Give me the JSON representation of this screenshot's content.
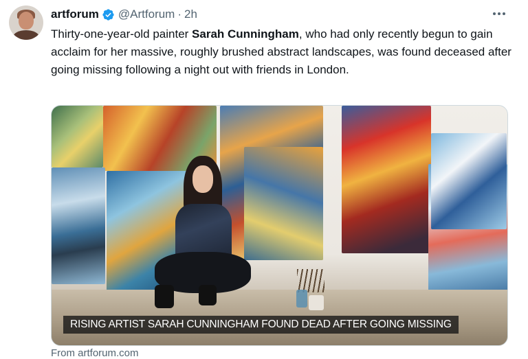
{
  "tweet": {
    "author_name": "artforum",
    "handle": "@Artforum",
    "separator": "·",
    "timestamp": "2h",
    "verified": true,
    "text_before": "Thirty-one-year-old painter ",
    "text_bold": "Sarah Cunningham",
    "text_after": ", who had only recently begun to gain acclaim for her massive, roughly brushed abstract landscapes, was found deceased after going missing following a night out with friends in London."
  },
  "media": {
    "caption": "RISING ARTIST SARAH CUNNINGHAM FOUND DEAD AFTER GOING MISSING"
  },
  "link": {
    "source": "From artforum.com"
  },
  "colors": {
    "text": "#0f1419",
    "secondary": "#536471",
    "verified": "#1d9bf0"
  },
  "icons": {
    "verified": "verified-badge-icon",
    "more": "more-options-icon"
  }
}
